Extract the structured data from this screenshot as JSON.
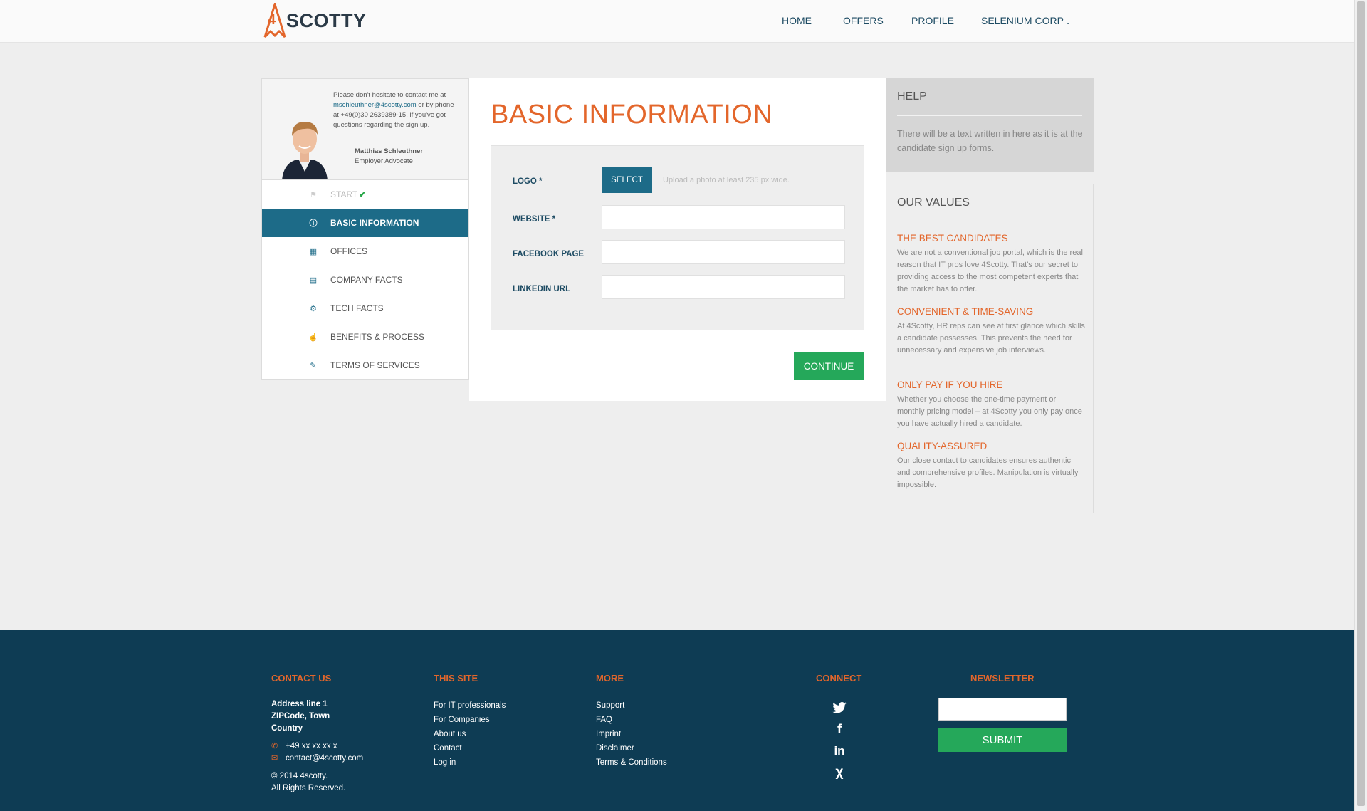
{
  "header": {
    "logo_text": "SCOTTY",
    "nav": [
      {
        "label": "HOME"
      },
      {
        "label": "OFFERS"
      },
      {
        "label": "PROFILE"
      },
      {
        "label": "SELENIUM CORP"
      }
    ]
  },
  "advocate": {
    "text_before_email": "Please don't hesitate to contact me at ",
    "email": "mschleuthner@4scotty.com",
    "text_after_email": " or by phone at +49(0)30 2639389-15, if you've got questions regarding the sign up.",
    "name": "Matthias Schleuthner",
    "role": "Employer Advocate"
  },
  "steps": [
    {
      "label": "START",
      "icon": "flag-icon",
      "state": "done"
    },
    {
      "label": "BASIC INFORMATION",
      "icon": "info-icon",
      "state": "active"
    },
    {
      "label": "OFFICES",
      "icon": "map-icon",
      "state": "pending"
    },
    {
      "label": "COMPANY FACTS",
      "icon": "document-icon",
      "state": "pending"
    },
    {
      "label": "TECH FACTS",
      "icon": "gear-icon",
      "state": "pending"
    },
    {
      "label": "BENEFITS & PROCESS",
      "icon": "thumbs-up-icon",
      "state": "pending"
    },
    {
      "label": "TERMS OF SERVICES",
      "icon": "pen-icon",
      "state": "pending"
    }
  ],
  "main": {
    "title": "BASIC INFORMATION",
    "logo_label": "LOGO *",
    "select_label": "SELECT",
    "upload_hint": "Upload a photo at least 235 px wide.",
    "website_label": "WEBSITE *",
    "website_value": "",
    "facebook_label": "FACEBOOK PAGE",
    "facebook_value": "",
    "linkedin_label": "LINKEDIN URL",
    "linkedin_value": "",
    "continue_label": "CONTINUE"
  },
  "help": {
    "title": "HELP",
    "text": "There will be a text written in here as it is at the candidate sign up forms."
  },
  "values": {
    "title": "OUR VALUES",
    "items": [
      {
        "head": "THE BEST CANDIDATES",
        "body": "We are not a conventional job portal, which is the real reason that IT pros love 4Scotty. That's our secret to providing access to the most competent experts that the market has to offer."
      },
      {
        "head": "CONVENIENT & TIME-SAVING",
        "body": "At 4Scotty, HR reps can see at first glance which skills a candidate possesses. This prevents the need for unnecessary and expensive job interviews."
      },
      {
        "head": "ONLY PAY IF YOU HIRE",
        "body": "Whether you choose the one-time payment or monthly pricing model – at 4Scotty you only pay once you have actually hired a candidate."
      },
      {
        "head": "QUALITY-ASSURED",
        "body": "Our close contact to candidates ensures authentic and comprehensive profiles. Manipulation is virtually impossible."
      }
    ]
  },
  "footer": {
    "contact": {
      "head": "CONTACT US",
      "address1": "Address line 1",
      "address2": "ZIPCode, Town",
      "address3": "Country",
      "phone": "+49 xx xx xx x",
      "email": "contact@4scotty.com",
      "copyright": "© 2014 4scotty.",
      "rights": "All Rights Reserved."
    },
    "this_site": {
      "head": "THIS SITE",
      "links": [
        "For IT professionals",
        "For Companies",
        "About us",
        "Contact",
        "Log in"
      ]
    },
    "more": {
      "head": "MORE",
      "links": [
        "Support",
        "FAQ",
        "Imprint",
        "Disclaimer",
        "Terms & Conditions"
      ]
    },
    "connect": {
      "head": "CONNECT",
      "icons": [
        "twitter-icon",
        "facebook-icon",
        "linkedin-icon",
        "xing-icon"
      ]
    },
    "newsletter": {
      "head": "NEWSLETTER",
      "input_value": "",
      "submit_label": "SUBMIT"
    }
  },
  "colors": {
    "brand_orange": "#e3662b",
    "brand_teal": "#1d6b88",
    "footer_navy": "#0e3c54",
    "action_green": "#25a85a"
  }
}
